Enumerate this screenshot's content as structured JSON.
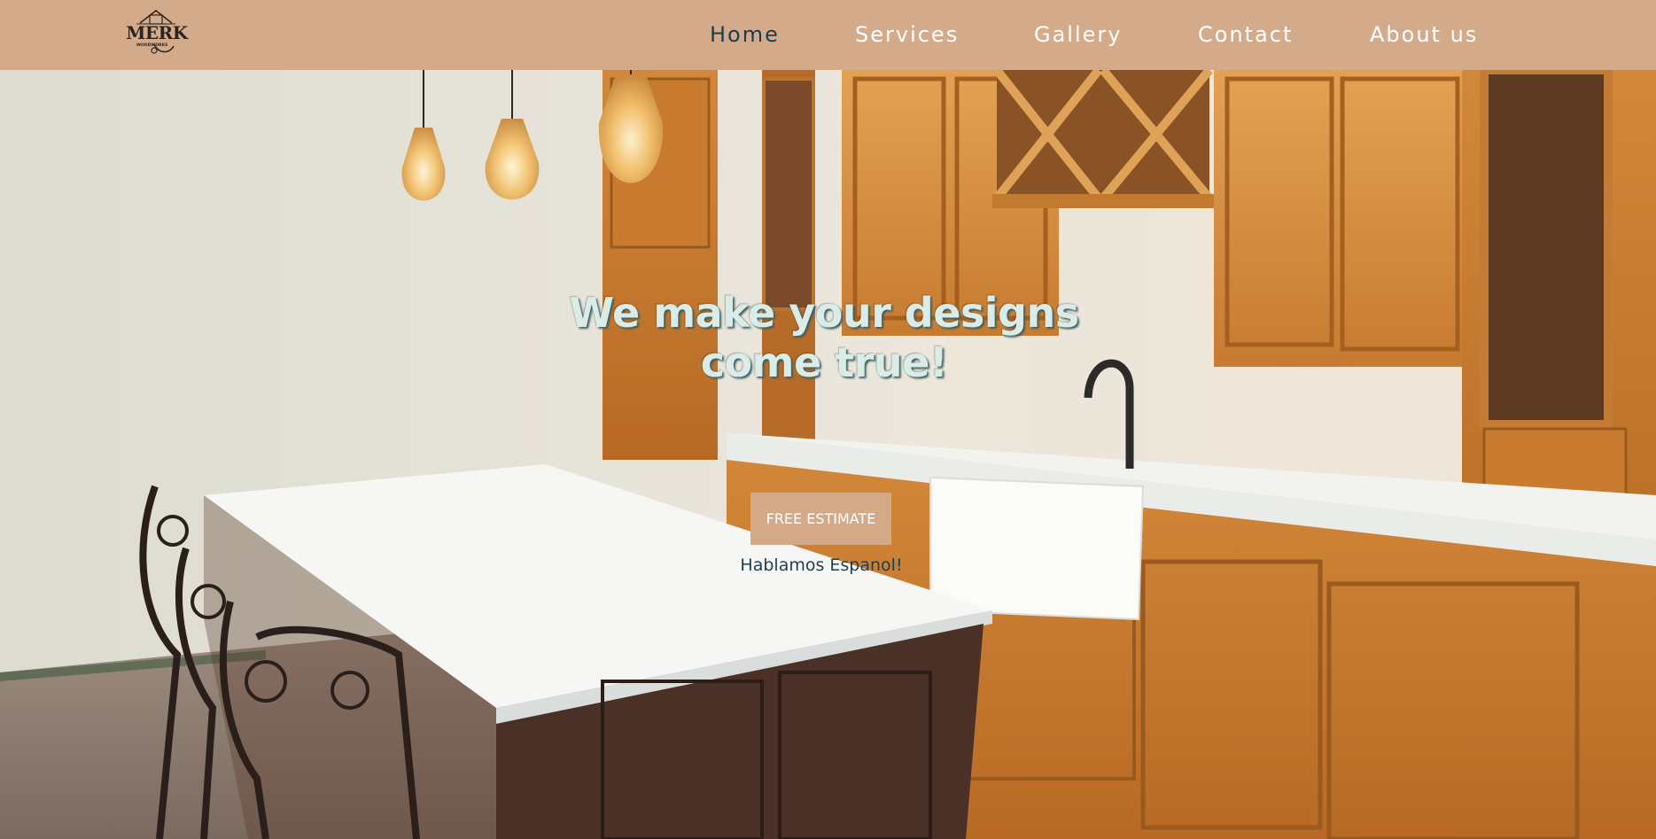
{
  "logo": {
    "text": "MERK",
    "subtext": "WOODWORKS",
    "icon": "merk-woodworks-logo"
  },
  "nav": {
    "items": [
      {
        "label": "Home",
        "active": true
      },
      {
        "label": "Services",
        "active": false
      },
      {
        "label": "Gallery",
        "active": false
      },
      {
        "label": "Contact",
        "active": false
      },
      {
        "label": "About us",
        "active": false
      }
    ]
  },
  "hero": {
    "headline_line1": "We make your designs",
    "headline_line2": "come true!",
    "cta_label": "FREE ESTIMATE",
    "subtext": "Hablamos Espanol!"
  },
  "colors": {
    "header_bg": "#d4ab8a",
    "nav_active": "#1e3b4b",
    "nav_text": "#ffffff",
    "cta_bg": "#d4a987",
    "headline_text": "#d9ece8",
    "subtext": "#1f3e4e"
  }
}
